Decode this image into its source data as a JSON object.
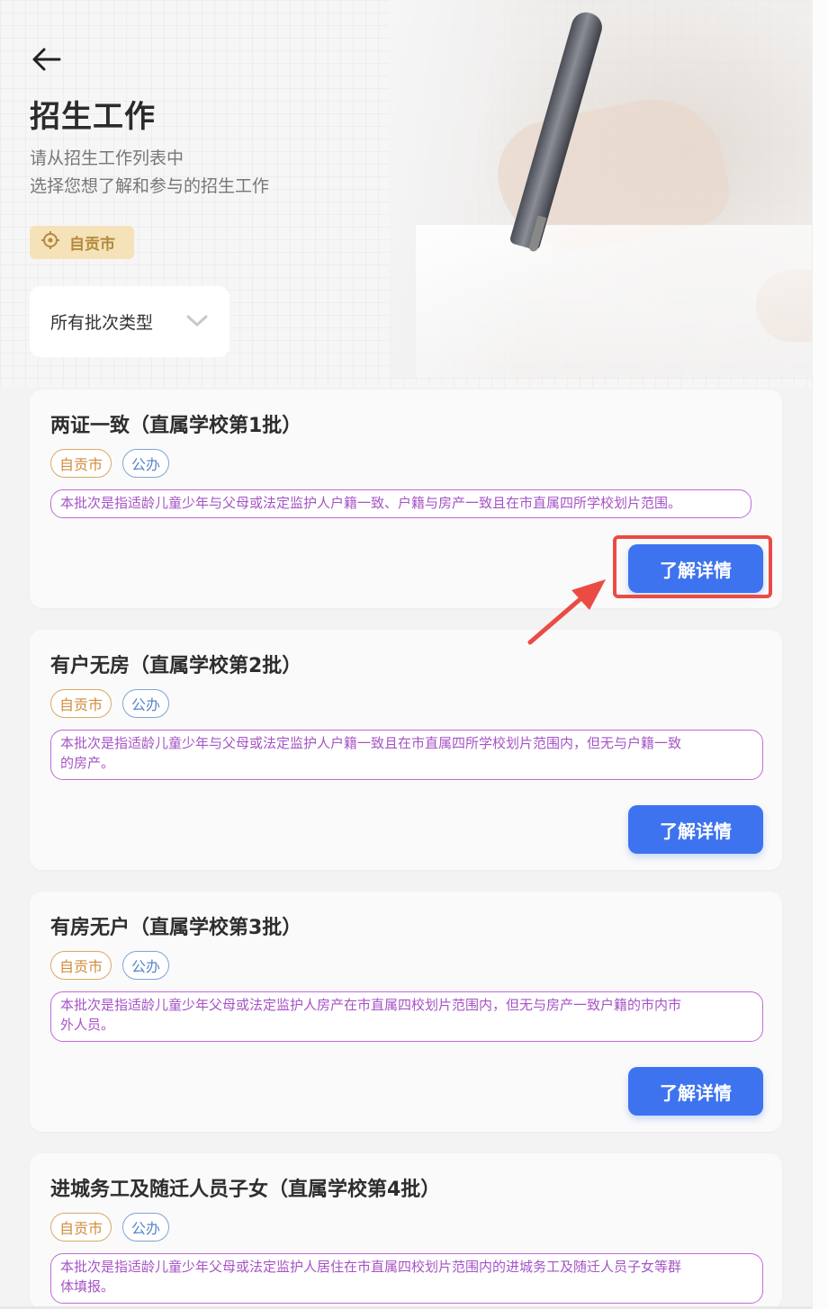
{
  "header": {
    "title": "招生工作",
    "subtitle_line1": "请从招生工作列表中",
    "subtitle_line2": "选择您想了解和参与的招生工作",
    "city": "自贡市"
  },
  "filter": {
    "batch_type": "所有批次类型"
  },
  "cards": [
    {
      "title": "两证一致（直属学校第1批）",
      "tag_city": "自贡市",
      "tag_type": "公办",
      "description_lines": [
        "本批次是指适龄儿童少年与父母或法定监护人户籍一致、户籍与房产一致且在市直属四所学校划片范围。"
      ],
      "button": "了解详情"
    },
    {
      "title": "有户无房（直属学校第2批）",
      "tag_city": "自贡市",
      "tag_type": "公办",
      "description_lines": [
        "本批次是指适龄儿童少年与父母或法定监护人户籍一致且在市直属四所学校划片范围内，但无与户籍一致",
        "的房产。"
      ],
      "button": "了解详情"
    },
    {
      "title": "有房无户（直属学校第3批）",
      "tag_city": "自贡市",
      "tag_type": "公办",
      "description_lines": [
        "本批次是指适龄儿童少年父母或法定监护人房产在市直属四校划片范围内，但无与房产一致户籍的市内市",
        "外人员。"
      ],
      "button": "了解详情"
    },
    {
      "title": "进城务工及随迁人员子女（直属学校第4批）",
      "tag_city": "自贡市",
      "tag_type": "公办",
      "description_lines": [
        "本批次是指适龄儿童少年父母或法定监护人居住在市直属四校划片范围内的进城务工及随迁人员子女等群",
        "体填报。"
      ]
    }
  ],
  "colors": {
    "primary_button": "#3d73ee",
    "highlight_annotation": "#ea4b43",
    "description_border": "#c16bd8",
    "city_tag": "#d08d3e",
    "public_tag": "#5a86c5"
  }
}
